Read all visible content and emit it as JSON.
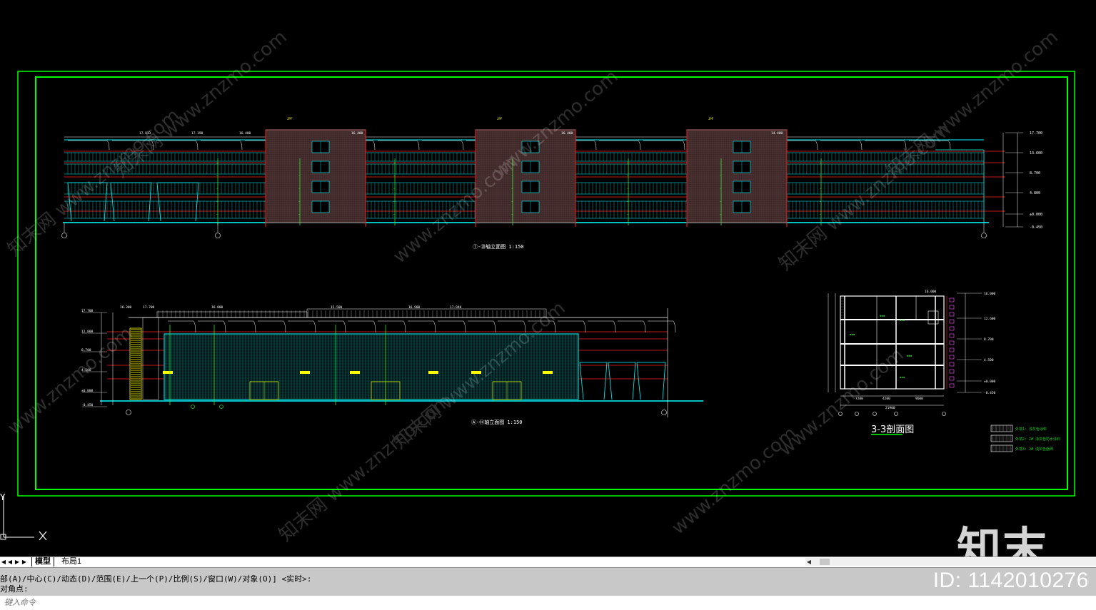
{
  "colors": {
    "background": "#000000",
    "frame": "#00ff00",
    "cyan": "#00ffff",
    "red": "#ff2020",
    "green": "#33ff33",
    "yellow": "#ffff00",
    "white": "#ffffff",
    "magenta_grey": "#b07070"
  },
  "drawing": {
    "elevation_1_title": "①-⑳轴立面图 1:150",
    "elevation_2_title": "Ⓐ-Ⓗ轴立面图 1:150",
    "section_title": "3-3剖面图",
    "top_levels_right": [
      "17.700",
      "13.600",
      "8.700",
      "4.800",
      "±0.000",
      "-0.450"
    ],
    "top_level_tags": [
      "17.813",
      "17.190",
      "16.400",
      "16.400",
      "16.400",
      "14.400"
    ],
    "left_levels": [
      "17.700",
      "12.800",
      "8.700",
      "4.500",
      "±0.000",
      "-0.450"
    ],
    "left_tags": [
      "16.300",
      "17.700",
      "16.800",
      "15.500",
      "16.900",
      "17.940"
    ],
    "section_levels": [
      "16.000",
      "12.600",
      "8.700",
      "4.500",
      "±0.000",
      "-0.450"
    ],
    "section_dims_bottom": [
      "7200",
      "4200",
      "9600",
      "21900"
    ],
    "legend_items": [
      "外墙1: 浅灰色涂料",
      "外墙2: 2#  浅灰色防水涂料",
      "外墙3: 2#  浅灰色面砖"
    ]
  },
  "tabs": {
    "model": "模型",
    "layout1": "布局1"
  },
  "command": {
    "line1": "部(A)/中心(C)/动态(D)/范围(E)/上一个(P)/比例(S)/窗口(W)/对象(O)] <实时>:",
    "line2": "对角点:",
    "input_placeholder": "键入命令"
  },
  "watermarks": {
    "id_text": "ID: 1142010276",
    "brand": "知末",
    "site": "www.znzmo.com",
    "site_cn": "知末网"
  },
  "ucs": {
    "axis_label": "Y"
  }
}
